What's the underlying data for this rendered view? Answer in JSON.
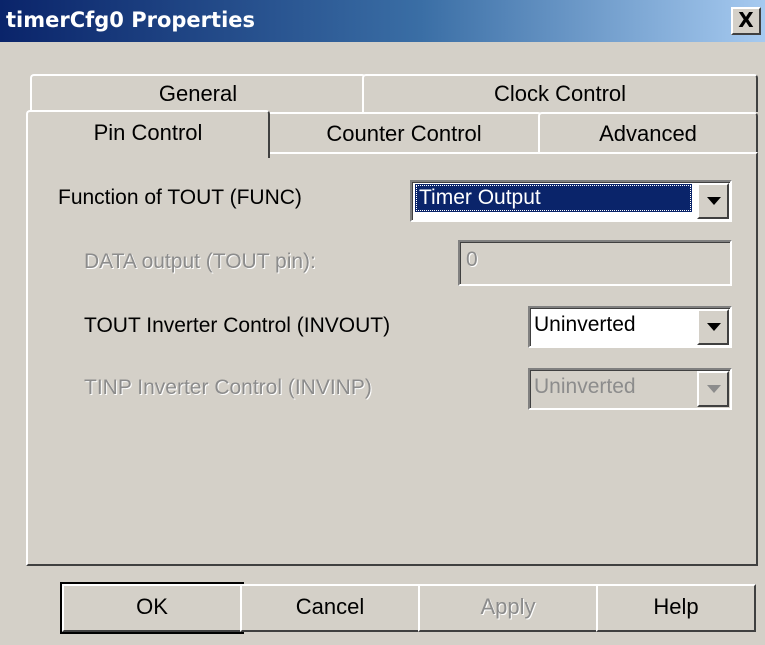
{
  "window": {
    "title": "timerCfg0 Properties",
    "close_label": "X"
  },
  "tabs": {
    "row_back": [
      {
        "label": "General"
      },
      {
        "label": "Clock Control"
      }
    ],
    "row_front": [
      {
        "label": "Pin Control",
        "selected": true
      },
      {
        "label": "Counter Control"
      },
      {
        "label": "Advanced"
      }
    ]
  },
  "form": {
    "func": {
      "label": "Function of TOUT (FUNC)",
      "value": "Timer Output",
      "enabled": true
    },
    "data_output": {
      "label": "DATA output (TOUT pin):",
      "value": "0",
      "enabled": false
    },
    "invout": {
      "label": "TOUT Inverter Control (INVOUT)",
      "value": "Uninverted",
      "enabled": true
    },
    "invinp": {
      "label": "TINP Inverter Control (INVINP)",
      "value": "Uninverted",
      "enabled": false
    }
  },
  "buttons": {
    "ok": "OK",
    "cancel": "Cancel",
    "apply": "Apply",
    "help": "Help"
  },
  "colors": {
    "title_gradient_start": "#0a246a",
    "title_gradient_end": "#a6caf0",
    "face": "#d4d0c8",
    "selection": "#0a246a",
    "disabled_text": "#8c8c8c"
  }
}
